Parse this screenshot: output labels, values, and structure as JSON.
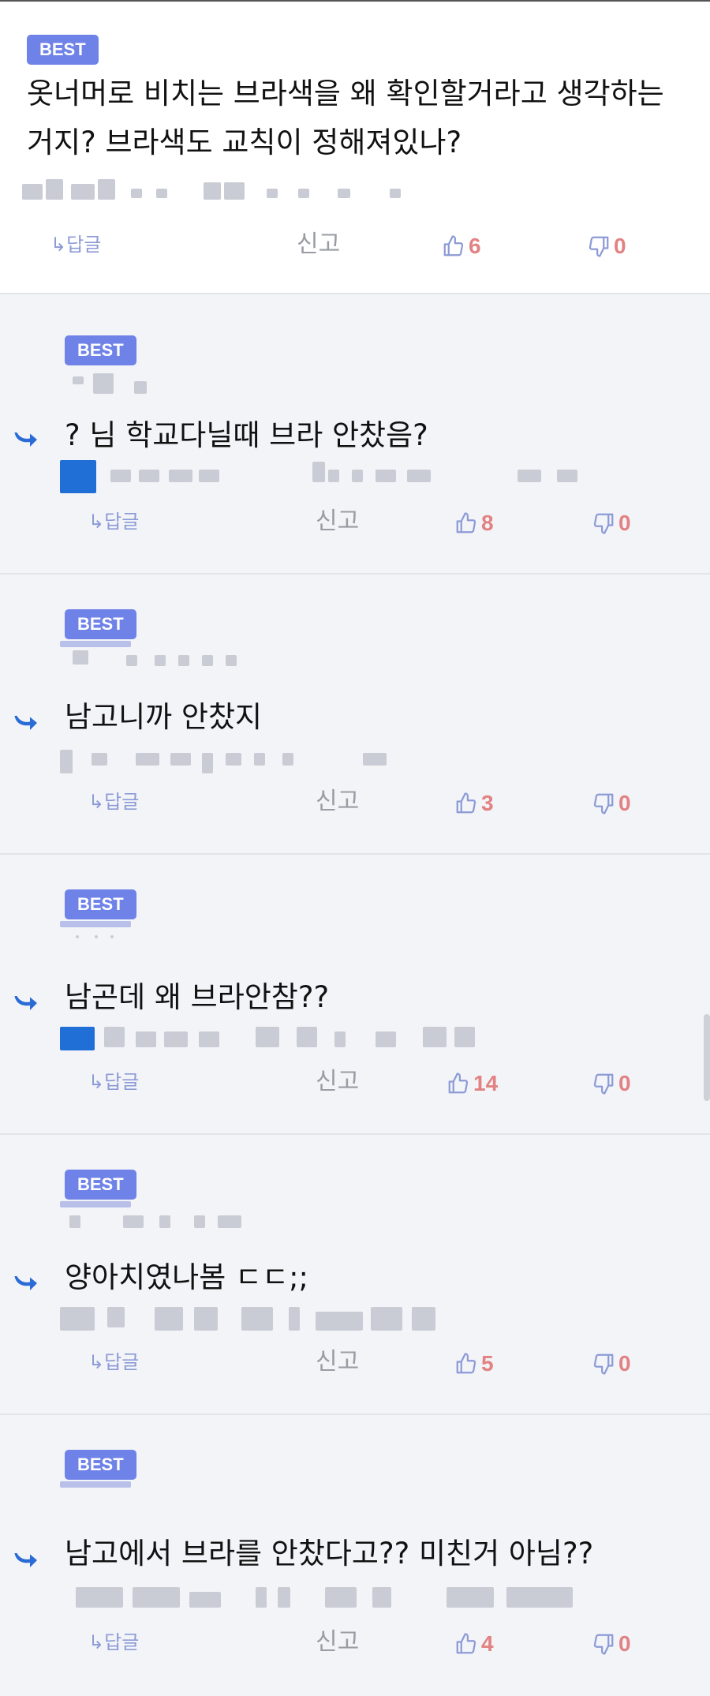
{
  "labels": {
    "best": "BEST",
    "reply": "답글",
    "report": "신고"
  },
  "comments": [
    {
      "text": "옷너머로 비치는 브라색을 왜 확인할거라고 생각하는거지? 브라색도 교칙이 정해져있나?",
      "likes": "6",
      "dislikes": "0"
    },
    {
      "text": "? 님 학교다닐때 브라 안찼음?",
      "likes": "8",
      "dislikes": "0"
    },
    {
      "text": "남고니까 안찼지",
      "likes": "3",
      "dislikes": "0"
    },
    {
      "text": "남곤데 왜 브라안참??",
      "likes": "14",
      "dislikes": "0"
    },
    {
      "text": "양아치였나봄 ㄷㄷ;;",
      "likes": "5",
      "dislikes": "0"
    },
    {
      "text": "남고에서 브라를 안찼다고?? 미친거 아님??",
      "likes": "4",
      "dislikes": "0"
    }
  ],
  "icons": {
    "reply_arrow": "reply-arrow-icon",
    "thumbs_up": "thumbs-up-icon",
    "thumbs_down": "thumbs-down-icon"
  },
  "colors": {
    "badge": "#6f82e8",
    "count": "#e28282",
    "reply_link": "#8d9bd6",
    "arrow": "#2a6bd6"
  }
}
